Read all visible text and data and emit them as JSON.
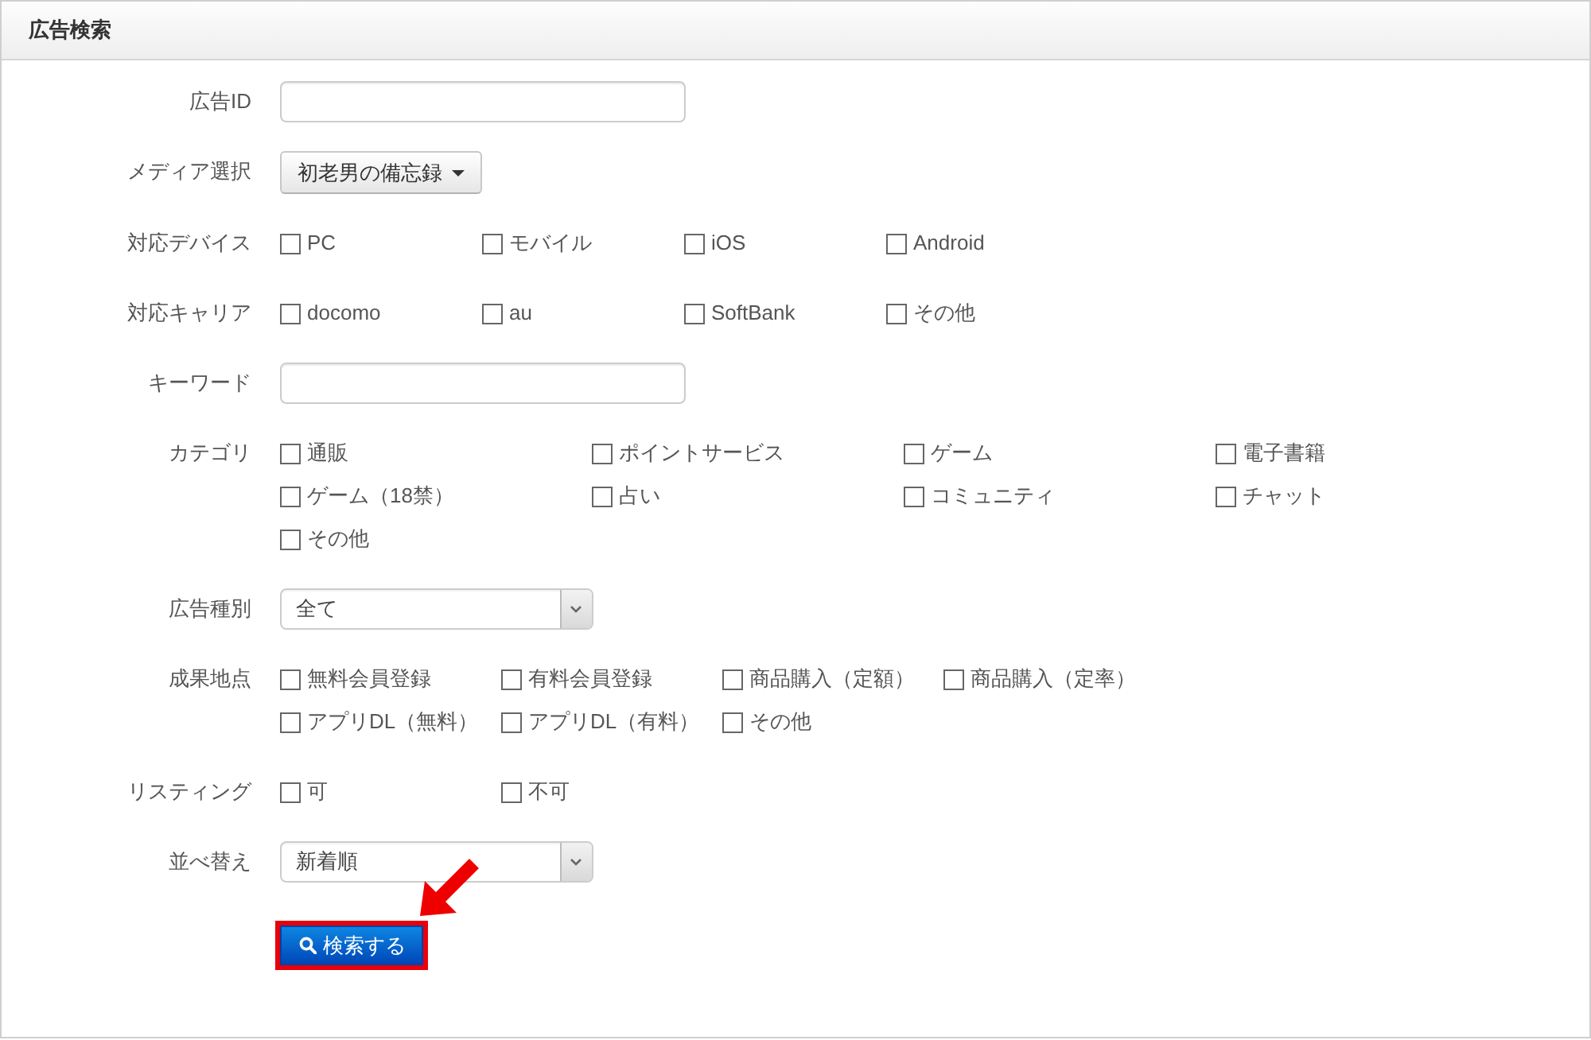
{
  "panel": {
    "title": "広告検索"
  },
  "fields": [
    {
      "kind": "text",
      "label": "広告ID"
    },
    {
      "kind": "dropdown",
      "label": "メディア選択",
      "value": "初老男の備忘録"
    },
    {
      "kind": "checkboxes",
      "label": "対応デバイス",
      "options": [
        {
          "label": "PC",
          "checked": false
        },
        {
          "label": "モバイル",
          "checked": false
        },
        {
          "label": "iOS",
          "checked": false
        },
        {
          "label": "Android",
          "checked": false
        }
      ]
    },
    {
      "kind": "checkboxes",
      "label": "対応キャリア",
      "options": [
        {
          "label": "docomo",
          "checked": false
        },
        {
          "label": "au",
          "checked": false
        },
        {
          "label": "SoftBank",
          "checked": false
        },
        {
          "label": "その他",
          "checked": false
        }
      ]
    },
    {
      "kind": "text",
      "label": "キーワード"
    },
    {
      "kind": "checkboxes",
      "label": "カテゴリ",
      "options": [
        {
          "label": "通販",
          "checked": false
        },
        {
          "label": "ポイントサービス",
          "checked": false
        },
        {
          "label": "ゲーム",
          "checked": false
        },
        {
          "label": "電子書籍",
          "checked": false
        },
        {
          "label": "ゲーム（18禁）",
          "checked": false
        },
        {
          "label": "占い",
          "checked": false
        },
        {
          "label": "コミュニティ",
          "checked": false
        },
        {
          "label": "チャット",
          "checked": false
        },
        {
          "label": "その他",
          "checked": false
        }
      ]
    },
    {
      "kind": "select",
      "label": "広告種別",
      "value": "全て"
    },
    {
      "kind": "checkboxes",
      "label": "成果地点",
      "options": [
        {
          "label": "無料会員登録",
          "checked": false
        },
        {
          "label": "有料会員登録",
          "checked": false
        },
        {
          "label": "商品購入（定額）",
          "checked": false
        },
        {
          "label": "商品購入（定率）",
          "checked": false
        },
        {
          "label": "アプリDL（無料）",
          "checked": false
        },
        {
          "label": "アプリDL（有料）",
          "checked": false
        },
        {
          "label": "その他",
          "checked": false
        }
      ]
    },
    {
      "kind": "checkboxes",
      "label": "リスティング",
      "options": [
        {
          "label": "可",
          "checked": false
        },
        {
          "label": "不可",
          "checked": false
        }
      ]
    },
    {
      "kind": "select",
      "label": "並べ替え",
      "value": "新着順"
    }
  ],
  "search_button": {
    "label": "検索する",
    "highlighted": true
  }
}
